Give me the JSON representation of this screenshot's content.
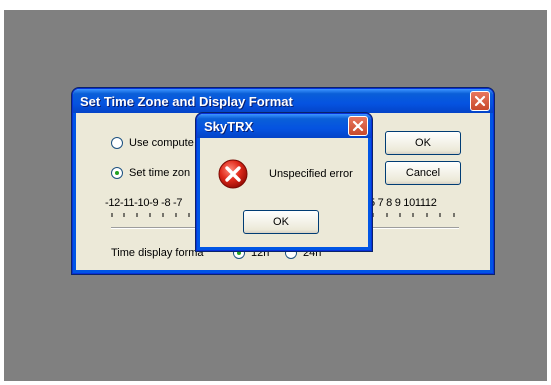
{
  "main_dialog": {
    "title": "Set Time Zone and Display Format",
    "option_use_computer": "Use compute",
    "option_set_timezone": "Set time zon",
    "ok_label": "OK",
    "cancel_label": "Cancel",
    "ticks_left": "-12-11-10-9 -8 -7",
    "ticks_right": "5 7 8 9 101112",
    "time_display_label": "Time display forma",
    "format_12h": "12h",
    "format_24h": "24h"
  },
  "error_dialog": {
    "title": "SkyTRX",
    "message": "Unspecified error",
    "ok_label": "OK",
    "icon": "error-icon"
  }
}
